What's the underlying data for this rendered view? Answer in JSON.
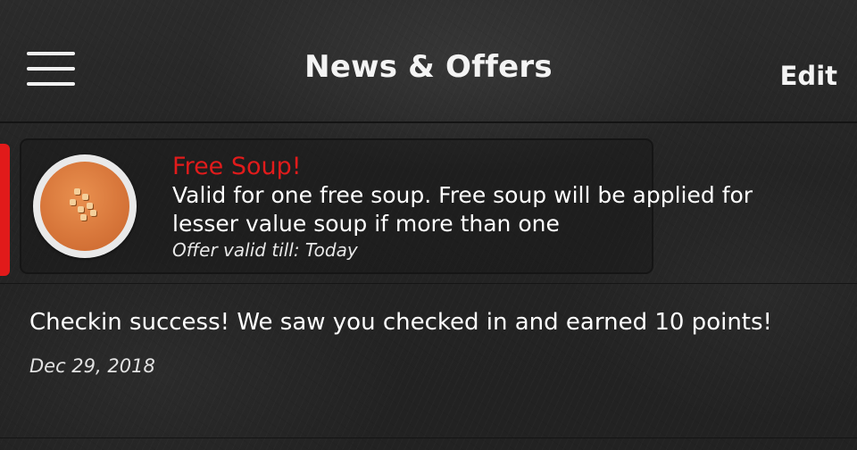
{
  "header": {
    "title": "News & Offers",
    "edit_label": "Edit",
    "menu_icon": "hamburger-menu-icon"
  },
  "offer": {
    "title": "Free Soup!",
    "description": "Valid for one free soup. Free soup will be applied for lesser value soup if more than one",
    "validity": "Offer valid till: Today",
    "image": "soup-bowl-icon",
    "title_color": "#e11b1b",
    "indicator_color": "#e11a1a"
  },
  "notification": {
    "text": "Checkin success! We saw you checked in and earned 10 points!",
    "date": "Dec 29, 2018"
  }
}
